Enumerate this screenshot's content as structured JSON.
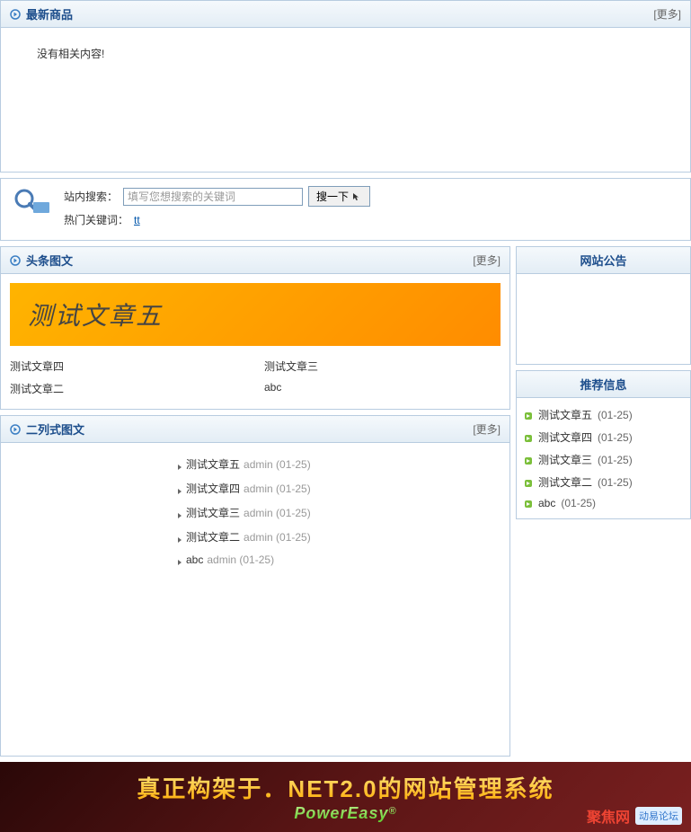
{
  "latest": {
    "title": "最新商品",
    "more": "[更多]",
    "empty": "没有相关内容!"
  },
  "search": {
    "label": "站内搜索：",
    "placeholder": "填写您想搜索的关键词",
    "button": "搜一下",
    "hot_label": "热门关键词：",
    "hot_link": "tt"
  },
  "headline": {
    "title": "头条图文",
    "more": "[更多]",
    "banner": "测试文章五",
    "links": [
      "测试文章四",
      "测试文章三",
      "测试文章二",
      "abc"
    ]
  },
  "twocol": {
    "title": "二列式图文",
    "more": "[更多]",
    "items": [
      {
        "title": "测试文章五",
        "author": "admin",
        "date": "(01-25)"
      },
      {
        "title": "测试文章四",
        "author": "admin",
        "date": "(01-25)"
      },
      {
        "title": "测试文章三",
        "author": "admin",
        "date": "(01-25)"
      },
      {
        "title": "测试文章二",
        "author": "admin",
        "date": "(01-25)"
      },
      {
        "title": "abc",
        "author": "admin",
        "date": "(01-25)"
      }
    ]
  },
  "announce": {
    "title": "网站公告"
  },
  "recommend": {
    "title": "推荐信息",
    "items": [
      {
        "title": "测试文章五",
        "date": "(01-25)"
      },
      {
        "title": "测试文章四",
        "date": "(01-25)"
      },
      {
        "title": "测试文章三",
        "date": "(01-25)"
      },
      {
        "title": "测试文章二",
        "date": "(01-25)"
      },
      {
        "title": "abc",
        "date": "(01-25)"
      }
    ]
  },
  "footer": {
    "main": "真正构架于．NET2.0的网站管理系统",
    "sub_brand": "PowerEasy",
    "sub_reg": "®",
    "logo1": "聚焦网",
    "logo2": "动易论坛"
  }
}
